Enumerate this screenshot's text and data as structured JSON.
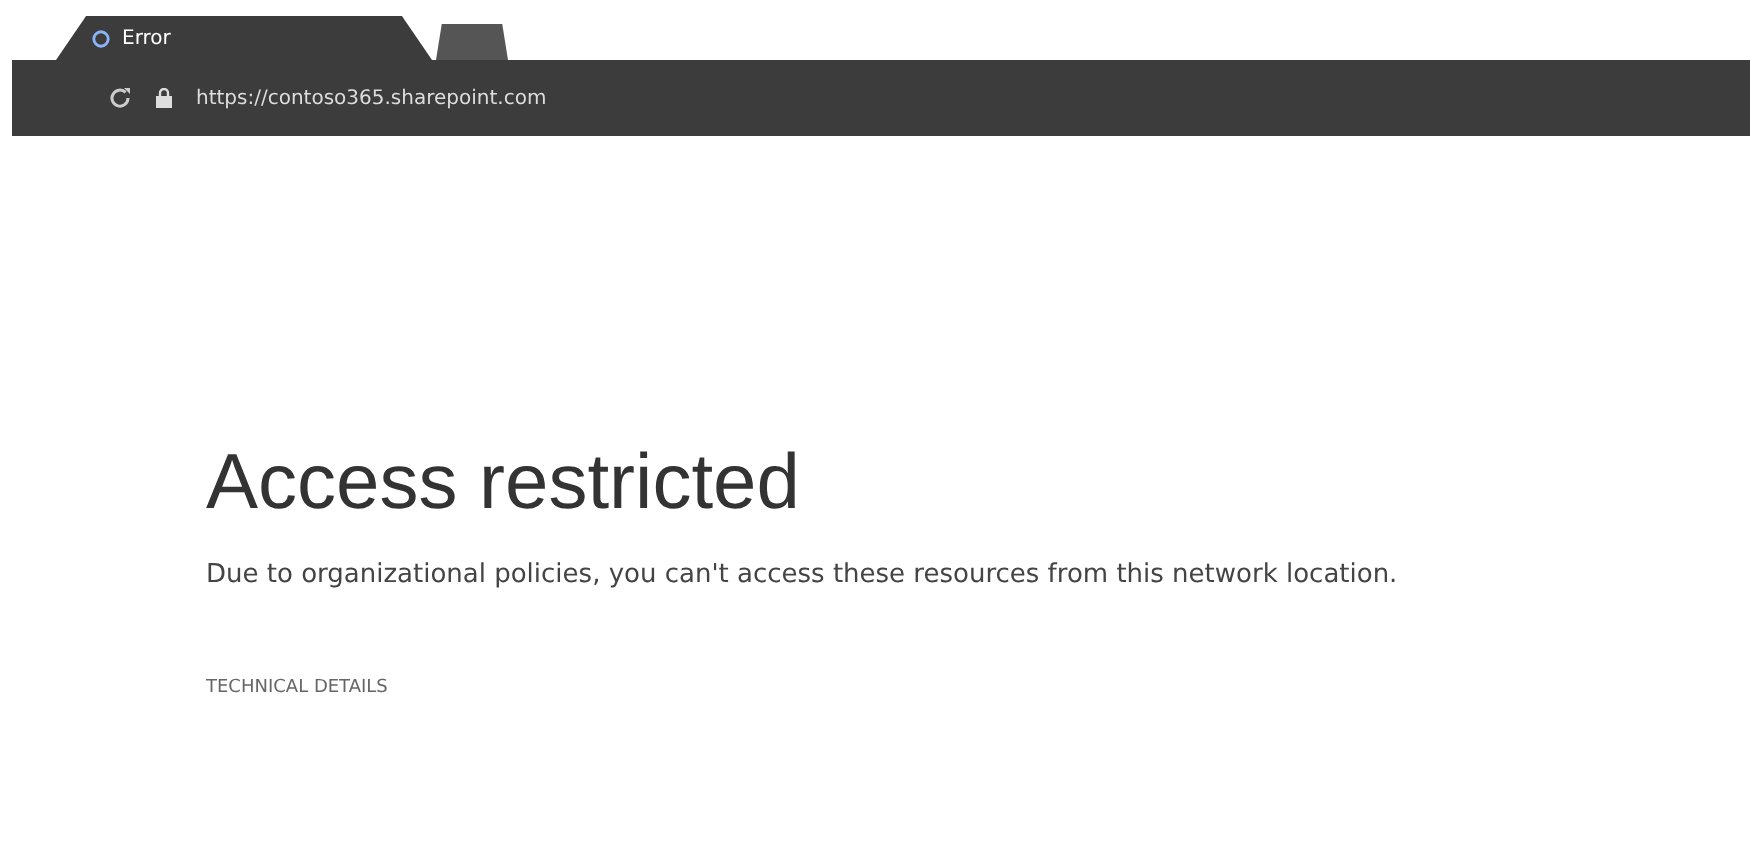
{
  "browser": {
    "tabs": [
      {
        "title": "Error",
        "selected": true
      },
      {
        "selected": false
      }
    ],
    "address": "https://contoso365.sharepoint.com"
  },
  "page": {
    "heading": "Access restricted",
    "message": "Due to organizational policies, you can't access these resources from this network location.",
    "details_link": "TECHNICAL DETAILS"
  }
}
